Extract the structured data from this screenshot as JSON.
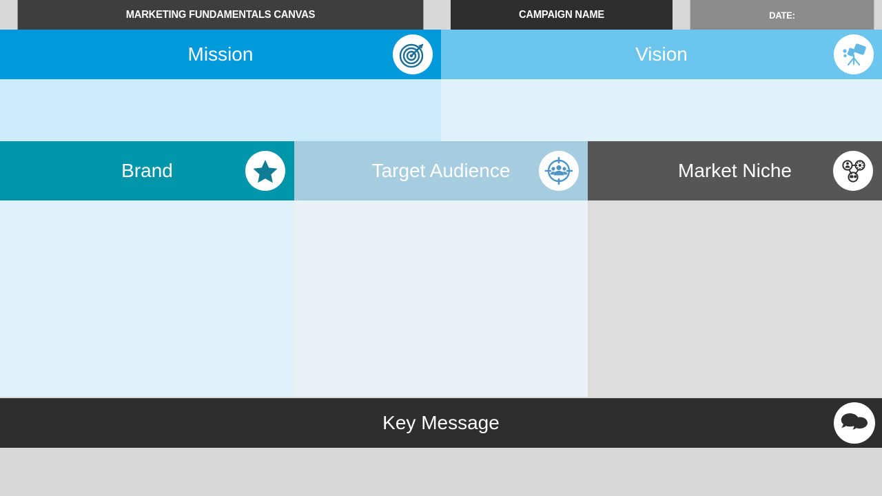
{
  "topbar": {
    "title": "MARKETING FUNDAMENTALS CANVAS",
    "campaign_label": "CAMPAIGN NAME",
    "date_label": "DATE:"
  },
  "sections": {
    "mission": {
      "label": "Mission",
      "icon": "target-icon",
      "header_color": "#0099dc",
      "body_color": "#cbeafa",
      "icon_color": "#1a6e96"
    },
    "vision": {
      "label": "Vision",
      "icon": "telescope-icon",
      "header_color": "#6cc5ec",
      "body_color": "#e1f1f9",
      "icon_color": "#63b9e3"
    },
    "brand": {
      "label": "Brand",
      "icon": "star-icon",
      "header_color": "#0095a8",
      "body_color": "#e1f1f9",
      "icon_color": "#0e7c92"
    },
    "target_audience": {
      "label": "Target Audience",
      "icon": "audience-crosshair-icon",
      "header_color": "#a6cce0",
      "body_color": "#ebf2f5",
      "icon_color": "#4f95c4"
    },
    "market_niche": {
      "label": "Market Niche",
      "icon": "network-nodes-icon",
      "header_color": "#565656",
      "body_color": "#dcdcdc",
      "icon_color": "#2e2e2e"
    },
    "key_message": {
      "label": "Key Message",
      "icon": "speech-bubbles-icon",
      "header_color": "#2e2e2e",
      "icon_color": "#2e2e2e"
    }
  },
  "page": {
    "background_color": "#d8d8d8"
  }
}
